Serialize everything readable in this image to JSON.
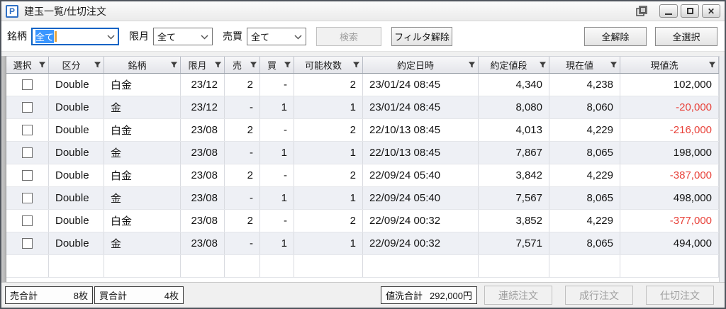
{
  "window": {
    "title": "建玉一覧/仕切注文",
    "icon_letter": "P"
  },
  "toolbar": {
    "filters": [
      {
        "label": "銘柄",
        "value": "全て",
        "focused": true
      },
      {
        "label": "限月",
        "value": "全て",
        "focused": false
      },
      {
        "label": "売買",
        "value": "全て",
        "focused": false
      }
    ],
    "search_button": "検索",
    "clear_filter_button": "フィルタ解除",
    "deselect_all_button": "全解除",
    "select_all_button": "全選択"
  },
  "table": {
    "columns": [
      "選択",
      "区分",
      "銘柄",
      "限月",
      "売",
      "買",
      "可能枚数",
      "約定日時",
      "約定値段",
      "現在値",
      "現値洗"
    ],
    "rows": [
      {
        "checked": false,
        "cells": [
          "Double",
          "白金",
          "23/12",
          "2",
          "-",
          "2",
          "23/01/24 08:45",
          "4,340",
          "4,238",
          "102,000"
        ]
      },
      {
        "checked": false,
        "cells": [
          "Double",
          "金",
          "23/12",
          "-",
          "1",
          "1",
          "23/01/24 08:45",
          "8,080",
          "8,060",
          "-20,000"
        ]
      },
      {
        "checked": false,
        "cells": [
          "Double",
          "白金",
          "23/08",
          "2",
          "-",
          "2",
          "22/10/13 08:45",
          "4,013",
          "4,229",
          "-216,000"
        ]
      },
      {
        "checked": false,
        "cells": [
          "Double",
          "金",
          "23/08",
          "-",
          "1",
          "1",
          "22/10/13 08:45",
          "7,867",
          "8,065",
          "198,000"
        ]
      },
      {
        "checked": false,
        "cells": [
          "Double",
          "白金",
          "23/08",
          "2",
          "-",
          "2",
          "22/09/24 05:40",
          "3,842",
          "4,229",
          "-387,000"
        ]
      },
      {
        "checked": false,
        "cells": [
          "Double",
          "金",
          "23/08",
          "-",
          "1",
          "1",
          "22/09/24 05:40",
          "7,567",
          "8,065",
          "498,000"
        ]
      },
      {
        "checked": false,
        "cells": [
          "Double",
          "白金",
          "23/08",
          "2",
          "-",
          "2",
          "22/09/24 00:32",
          "3,852",
          "4,229",
          "-377,000"
        ]
      },
      {
        "checked": false,
        "cells": [
          "Double",
          "金",
          "23/08",
          "-",
          "1",
          "1",
          "22/09/24 00:32",
          "7,571",
          "8,065",
          "494,000"
        ]
      }
    ]
  },
  "footer": {
    "sell_total_label": "売合計",
    "sell_total_value": "8枚",
    "buy_total_label": "買合計",
    "buy_total_value": "4枚",
    "wash_total_label": "値洗合計",
    "wash_total_value": "292,000円",
    "buttons": [
      "連続注文",
      "成行注文",
      "仕切注文"
    ]
  },
  "colors": {
    "negative": "#e8423a",
    "focus_border": "#0b63c5",
    "selection_bg": "#3a96ff",
    "caret": "#e8a43e"
  }
}
